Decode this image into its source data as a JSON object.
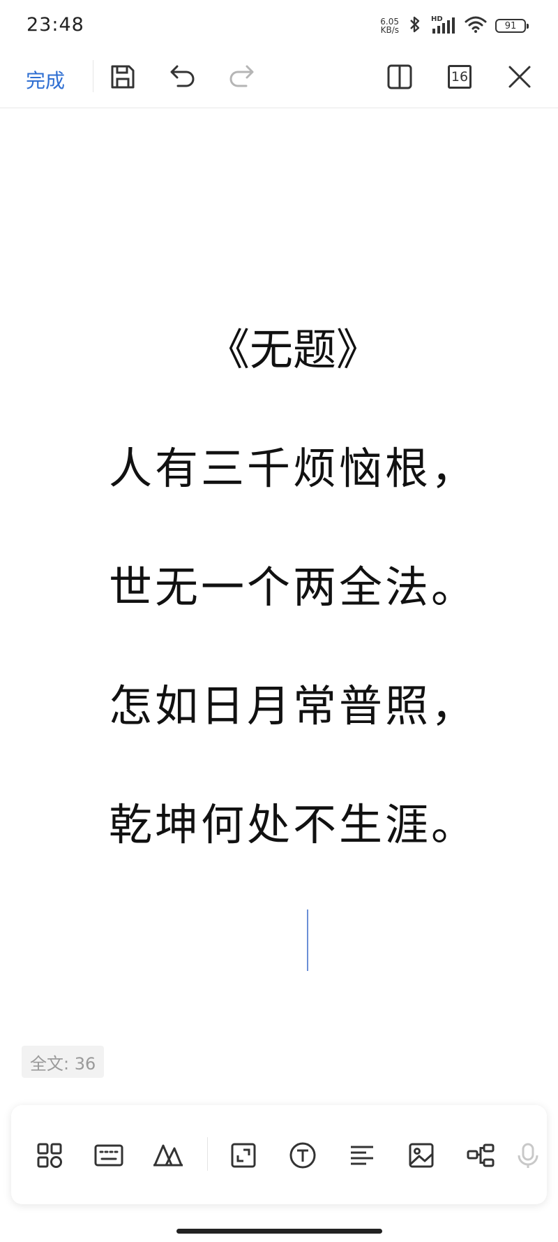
{
  "status_bar": {
    "time": "23:48",
    "net_speed_value": "6.05",
    "net_speed_unit": "KB/s",
    "hd_label": "HD",
    "battery": "91"
  },
  "toolbar": {
    "done_label": "完成",
    "page_number": "16"
  },
  "document": {
    "title": "《无题》",
    "lines": [
      "人有三千烦恼根，",
      "世无一个两全法。",
      "怎如日月常普照，",
      "乾坤何处不生涯。"
    ]
  },
  "word_count": "全文: 36",
  "colors": {
    "accent": "#2f6fd2",
    "caret": "#6b8fd6",
    "icon": "#333333",
    "icon_disabled": "#b5b5b5"
  },
  "bottom_toolbar": {
    "icons": [
      "apps-icon",
      "keyboard-icon",
      "text-style-icon",
      "resize-icon",
      "text-box-icon",
      "align-icon",
      "image-icon",
      "mindmap-icon",
      "microphone-icon"
    ]
  }
}
